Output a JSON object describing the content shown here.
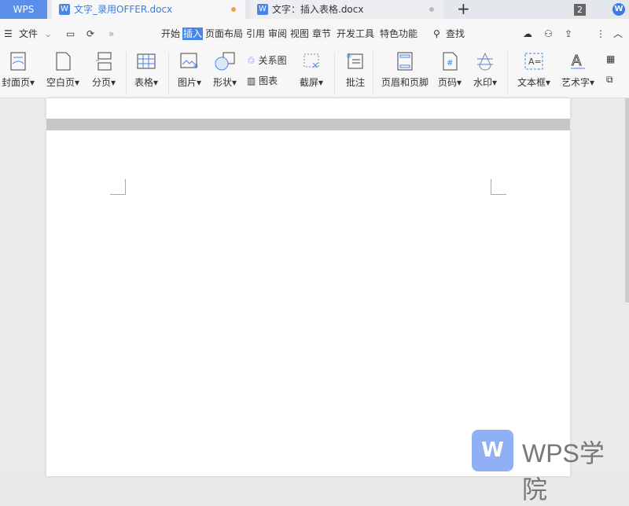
{
  "tabbar": {
    "app": "WPS",
    "tabs": [
      {
        "label": "文字_录用OFFER.docx",
        "active": true
      },
      {
        "label": "文字：插入表格.docx",
        "active": false
      }
    ],
    "new_tab": "+",
    "window_count": "2"
  },
  "menu": {
    "file": "文件",
    "items": [
      "开始",
      "插入",
      "页面布局",
      "引用",
      "审阅",
      "视图",
      "章节",
      "开发工具",
      "特色功能"
    ],
    "active": "插入",
    "search": "查找"
  },
  "ribbon": {
    "cover": "封面页",
    "blank": "空白页",
    "pagebreak": "分页",
    "table": "表格",
    "picture": "图片",
    "shape": "形状",
    "relation": "关系图",
    "chart": "图表",
    "screenshot": "截屏",
    "comment": "批注",
    "headerfooter": "页眉和页脚",
    "pagenum": "页码",
    "watermark": "水印",
    "textbox": "文本框",
    "wordart": "艺术字"
  },
  "watermark_logo": {
    "text": "WPS学院"
  },
  "colors": {
    "accent": "#4a86e8",
    "brand": "#5b8ee8"
  }
}
